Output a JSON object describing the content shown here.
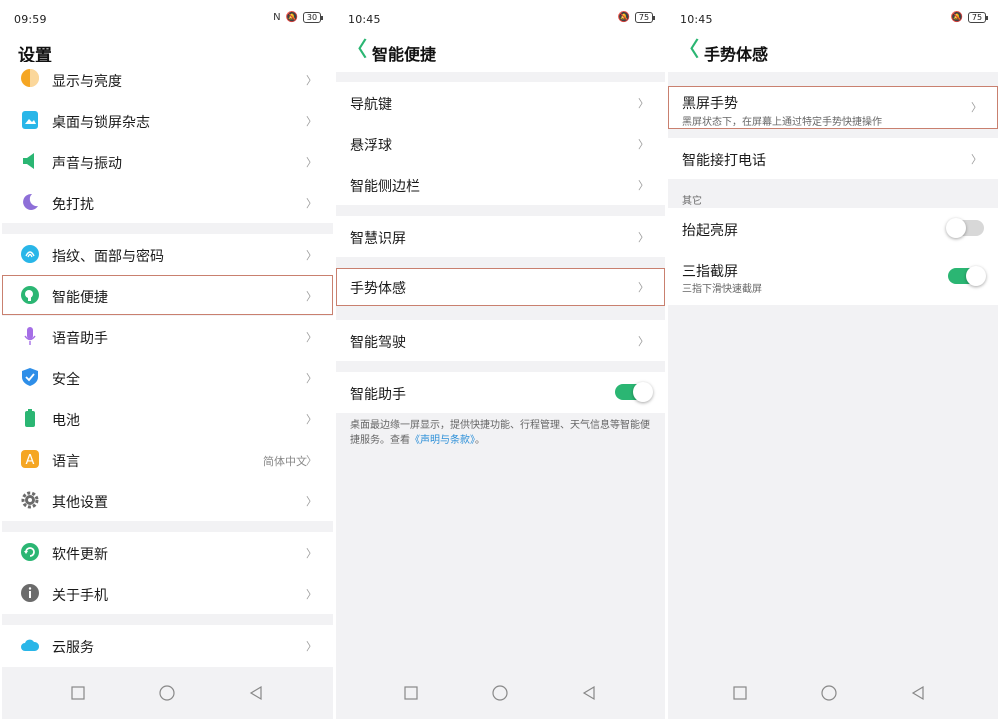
{
  "panel1": {
    "status": {
      "time": "09:59",
      "signal": "ᵃˡˡ ᵃˡˡ",
      "battery": "30"
    },
    "title": "设置",
    "items": [
      {
        "label": "显示与亮度",
        "icon": "brightness-icon",
        "color": "#f5a623"
      },
      {
        "label": "桌面与锁屏杂志",
        "icon": "wallpaper-icon",
        "color": "#29b6e8"
      },
      {
        "label": "声音与振动",
        "icon": "speaker-icon",
        "color": "#2bb673"
      },
      {
        "label": "免打扰",
        "icon": "moon-icon",
        "color": "#8e6fd8"
      },
      {
        "label": "指纹、面部与密码",
        "icon": "fingerprint-icon",
        "color": "#29b6e8"
      },
      {
        "label": "智能便捷",
        "icon": "smart-icon",
        "color": "#2bb673"
      },
      {
        "label": "语音助手",
        "icon": "microphone-icon",
        "color": "#a56ee6"
      },
      {
        "label": "安全",
        "icon": "shield-icon",
        "color": "#2e8ee8"
      },
      {
        "label": "电池",
        "icon": "battery-icon",
        "color": "#2bb673"
      },
      {
        "label": "语言",
        "icon": "language-icon",
        "color": "#f5a623",
        "value": "简体中文"
      },
      {
        "label": "其他设置",
        "icon": "gear-icon",
        "color": "#6b6b6b"
      },
      {
        "label": "软件更新",
        "icon": "update-icon",
        "color": "#2bb673"
      },
      {
        "label": "关于手机",
        "icon": "info-icon",
        "color": "#6b6b6b"
      },
      {
        "label": "云服务",
        "icon": "cloud-icon",
        "color": "#29b6e8"
      }
    ]
  },
  "panel2": {
    "status": {
      "time": "10:45",
      "signal": "ᵃˡˡ ᵃˡˡ",
      "battery": "75"
    },
    "title": "智能便捷",
    "items": [
      {
        "label": "导航键"
      },
      {
        "label": "悬浮球"
      },
      {
        "label": "智能侧边栏"
      },
      {
        "label": "智慧识屏"
      },
      {
        "label": "手势体感"
      },
      {
        "label": "智能驾驶"
      },
      {
        "label": "智能助手",
        "toggle": "on"
      }
    ],
    "note_text": "桌面最边缘一屏显示，提供快捷功能、行程管理、天气信息等智能便捷服务。查看",
    "note_link": "《声明与条款》",
    "note_end": "。"
  },
  "panel3": {
    "status": {
      "time": "10:45",
      "signal": "ᵃˡˡ ᵃˡˡ",
      "battery": "75"
    },
    "title": "手势体感",
    "items": [
      {
        "label": "黑屏手势",
        "sub": "黑屏状态下，在屏幕上通过特定手势快捷操作"
      },
      {
        "label": "智能接打电话"
      }
    ],
    "section_other": "其它",
    "other_items": [
      {
        "label": "抬起亮屏",
        "toggle": "off"
      },
      {
        "label": "三指截屏",
        "sub": "三指下滑快速截屏",
        "toggle": "on"
      }
    ]
  },
  "chevron": "〉",
  "back_glyph": "〈"
}
